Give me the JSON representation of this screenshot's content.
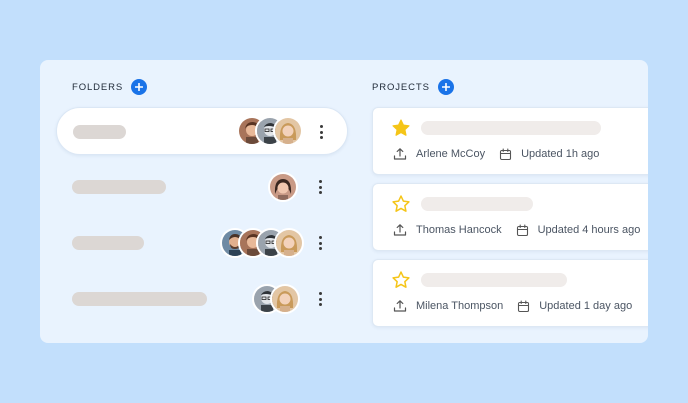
{
  "folders": {
    "heading": "FOLDERS",
    "add_icon": "plus-icon",
    "rows": [
      {
        "avatars": [
          "avatar-brown-hair",
          "avatar-glasses-man",
          "avatar-blonde-woman"
        ],
        "active": true
      },
      {
        "avatars": [
          "avatar-dark-hair-woman"
        ],
        "active": false
      },
      {
        "avatars": [
          "avatar-bearded-man",
          "avatar-brown-hair",
          "avatar-glasses-man",
          "avatar-blonde-woman"
        ],
        "active": false
      },
      {
        "avatars": [
          "avatar-glasses-man",
          "avatar-blonde-woman"
        ],
        "active": false
      }
    ],
    "more_icon": "kebab-menu-icon"
  },
  "projects": {
    "heading": "PROJECTS",
    "add_icon": "plus-icon",
    "items": [
      {
        "starred": true,
        "owner": "Arlene McCoy",
        "updated": "Updated 1h ago"
      },
      {
        "starred": false,
        "owner": "Thomas Hancock",
        "updated": "Updated 4 hours ago"
      },
      {
        "starred": false,
        "owner": "Milena Thompson",
        "updated": "Updated 1 day ago"
      }
    ],
    "icons": {
      "owner": "upload-icon",
      "date": "calendar-icon",
      "star": "star-icon"
    }
  },
  "colors": {
    "background": "#c2dffc",
    "panel": "#e9f3fe",
    "accent": "#1a73e8",
    "star": "#f5c518",
    "placeholder": "#dcd7d4"
  }
}
